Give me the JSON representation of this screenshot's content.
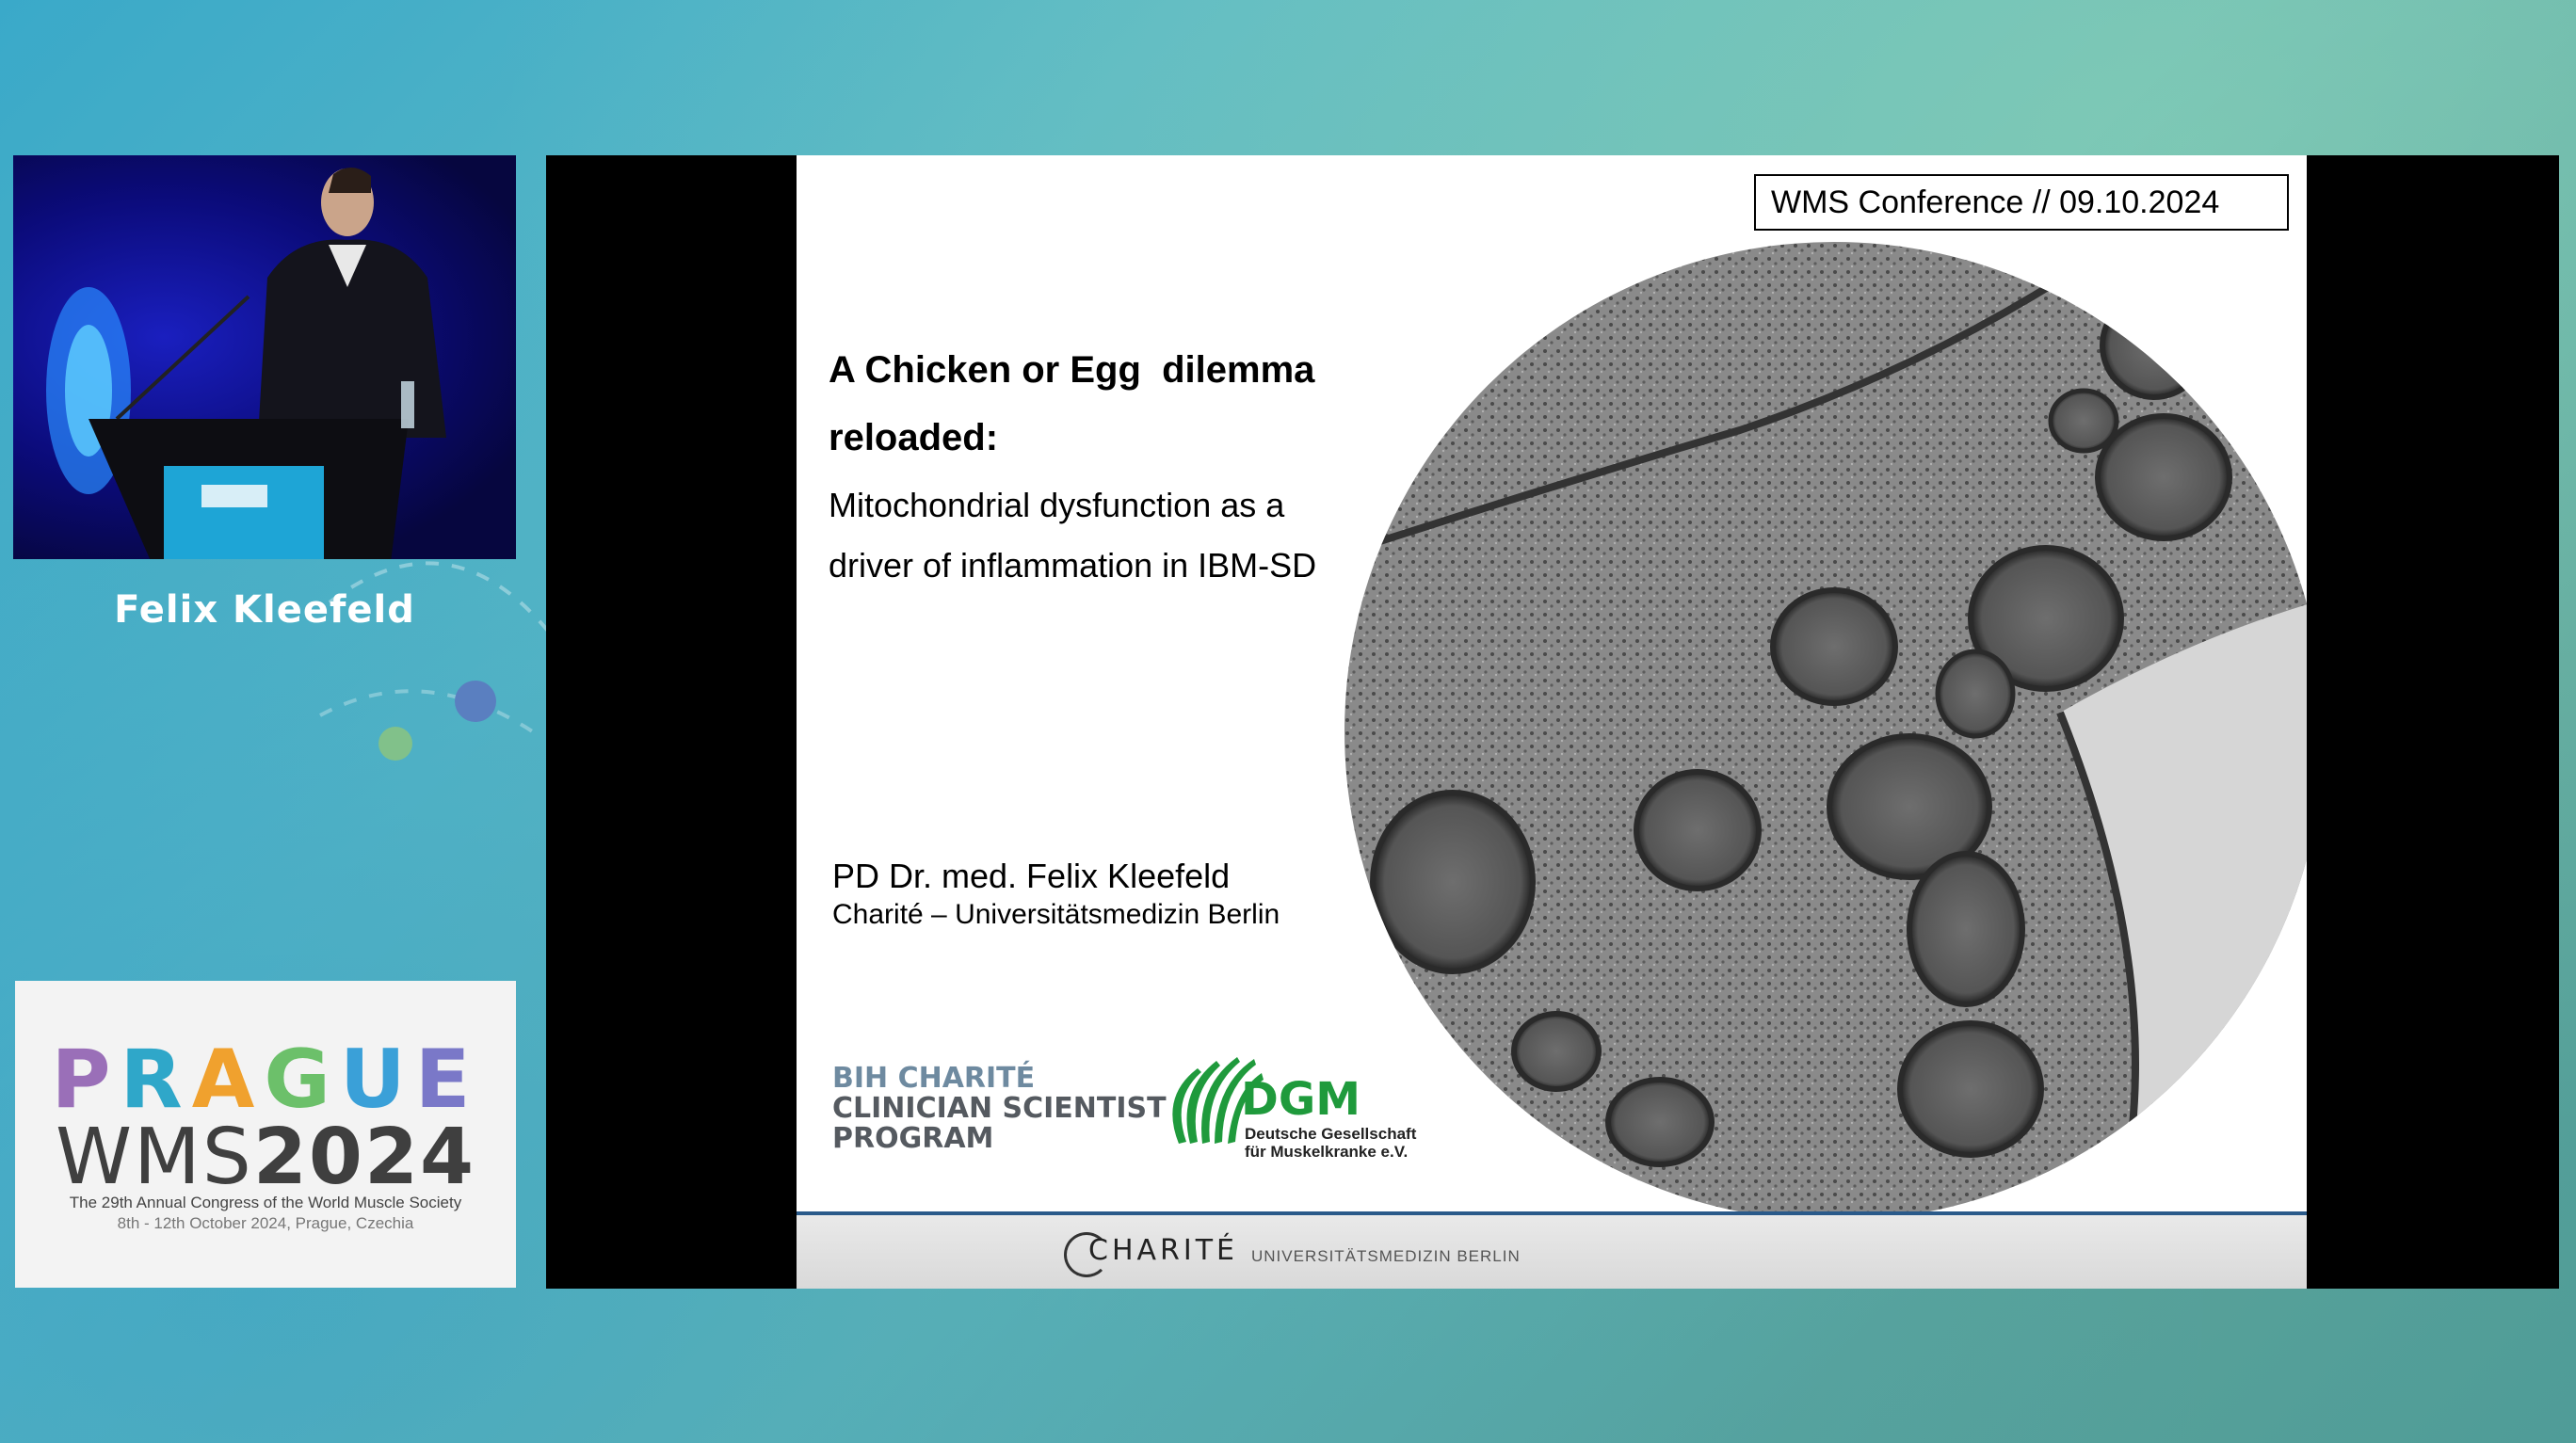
{
  "speaker": {
    "name": "Felix Kleefeld"
  },
  "event_logo": {
    "city": [
      "P",
      "R",
      "A",
      "G",
      "U",
      "E"
    ],
    "city_colors": [
      "#9a6fb8",
      "#2fa7c9",
      "#f0a12e",
      "#6cc06a",
      "#3aa0d8",
      "#7a78c8"
    ],
    "wms_prefix": "WMS",
    "year": "2024",
    "congress": "The 29th Annual Congress of the World Muscle Society",
    "dates": "8th - 12th October 2024, Prague, Czechia"
  },
  "slide": {
    "conference_tag": "WMS Conference // 09.10.2024",
    "title_line1": "A Chicken or Egg  dilemma",
    "title_line2": "reloaded:",
    "subtitle_line1": "Mitochondrial dysfunction as a",
    "subtitle_line2": "driver of inflammation in IBM-SD",
    "presenter": "PD Dr. med. Felix Kleefeld",
    "affiliation": "Charité – Universitätsmedizin Berlin",
    "bih_logo": {
      "line1": "BIH CHARITÉ",
      "line2": "CLINICIAN SCIENTIST",
      "line3": "PROGRAM"
    },
    "dgm_logo": {
      "name": "DGM",
      "line1": "Deutsche Gesellschaft",
      "line2": "für Muskelkranke e.V."
    },
    "footer": {
      "brand": "CHARITÉ",
      "sub": "UNIVERSITÄTSMEDIZIN BERLIN"
    }
  },
  "colors": {
    "slide_footer_rule": "#2a5a8a",
    "dgm_green": "#1f9a3c",
    "video_backdrop": "#0b0b7a"
  }
}
